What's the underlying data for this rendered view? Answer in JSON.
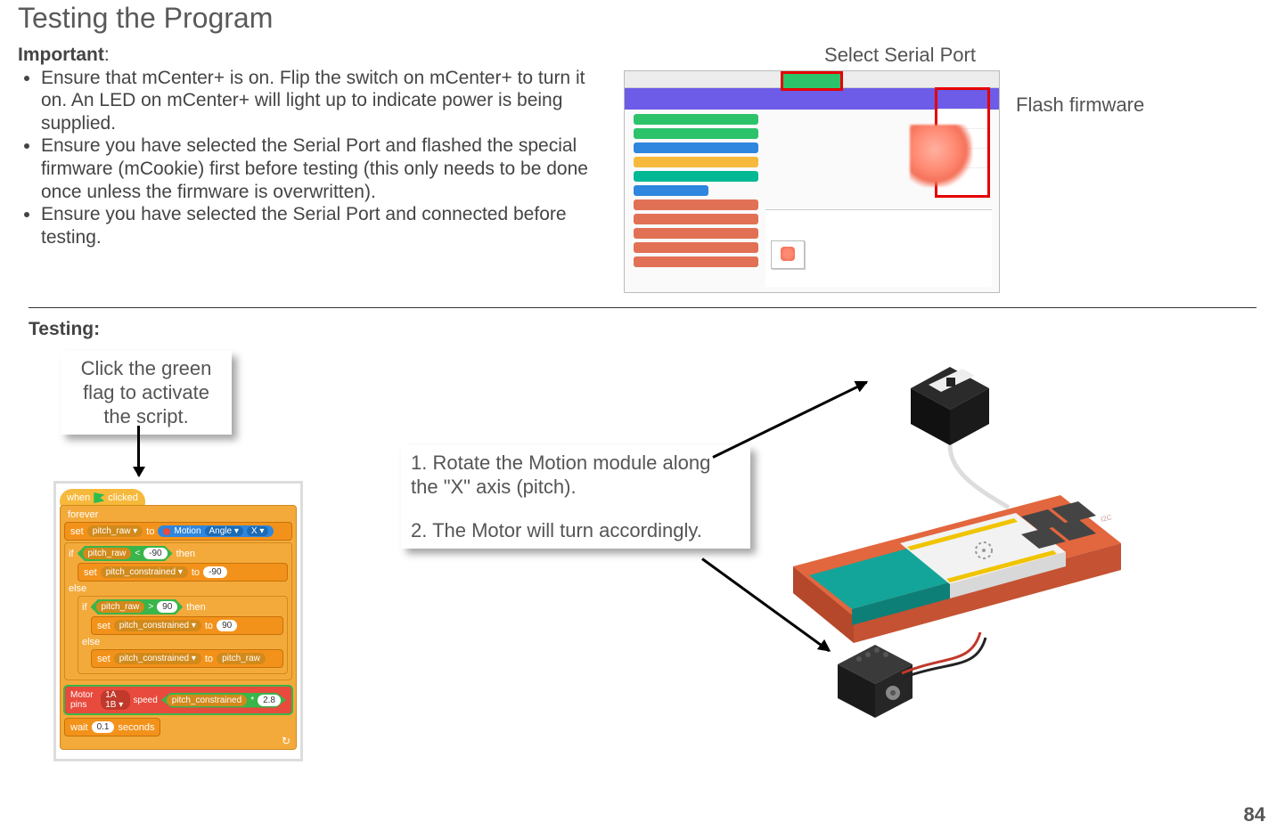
{
  "title": "Testing the Program",
  "important": {
    "heading": "Important",
    "bullets": [
      "Ensure that mCenter+ is on. Flip the switch on mCenter+ to turn it on. An LED on mCenter+ will light up to indicate power is being supplied.",
      "Ensure you have selected the Serial Port and flashed the special firmware (mCookie) first before testing (this only needs to be done once unless the firmware is overwritten).",
      "Ensure you have selected the Serial Port and connected before testing."
    ]
  },
  "labels": {
    "serial": "Select Serial Port",
    "flash": "Flash firmware",
    "testing": "Testing:"
  },
  "callouts": {
    "flag": "Click the green flag to activate the script.",
    "step1": "1. Rotate the Motion module along the \"X\" axis (pitch).",
    "step2": "2. The Motor will turn accordingly."
  },
  "code": {
    "hat_when": "when",
    "hat_clicked": "clicked",
    "forever": "forever",
    "set": "set",
    "to": "to",
    "if": "if",
    "then": "then",
    "else": "else",
    "pitch_raw": "pitch_raw ▾",
    "pitch_constrained": "pitch_constrained ▾",
    "motion": "Motion",
    "angle": "Angle ▾",
    "axis_x": "X ▾",
    "lt": "<",
    "gt": ">",
    "neg90": "-90",
    "pos90": "90",
    "motor_pins": "Motor pins",
    "pins_val": "1A 1B ▾",
    "speed": "speed",
    "mult": "*",
    "mult_val": "2.8",
    "wait": "wait",
    "wait_val": "0.1",
    "seconds": "seconds",
    "pitch_raw_plain": "pitch_raw",
    "pitch_constrained_plain": "pitch_constrained"
  },
  "page_number": "84"
}
